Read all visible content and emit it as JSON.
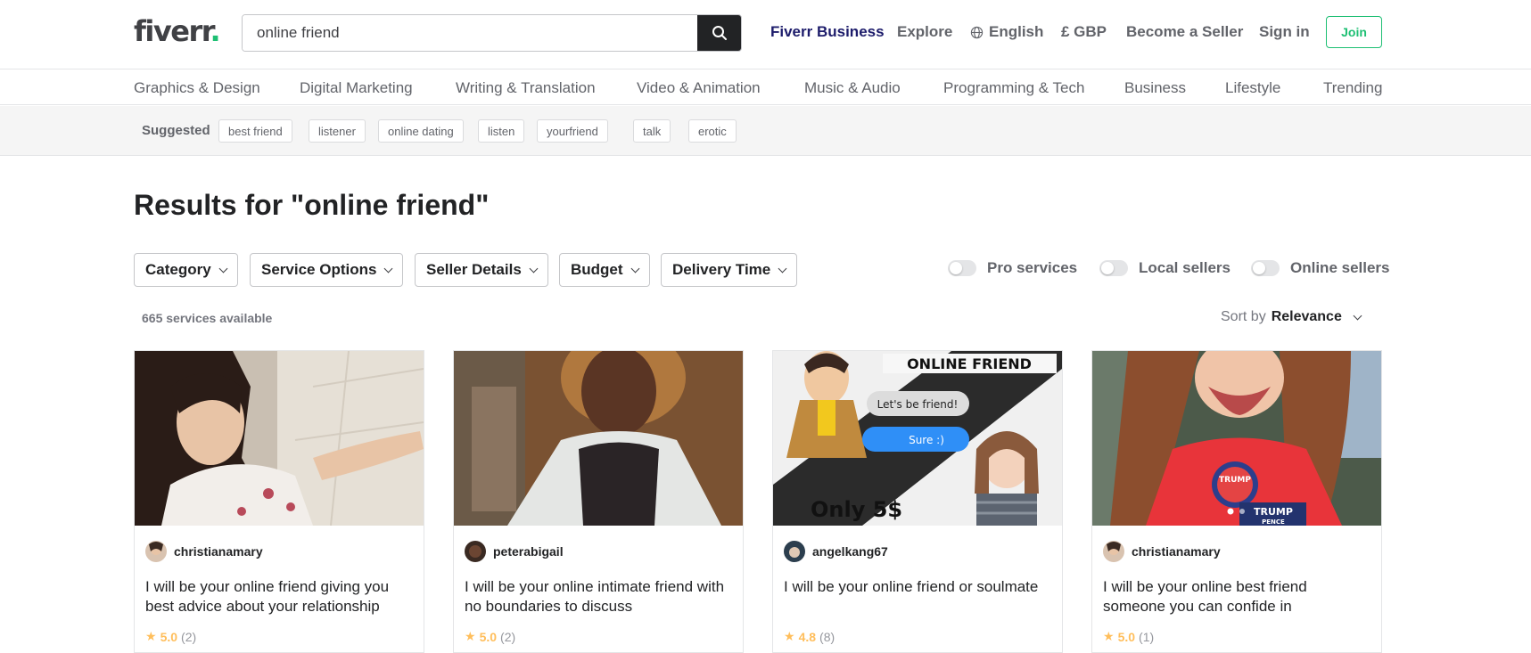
{
  "header": {
    "logo": "fiverr",
    "logo_dot": ".",
    "search_value": "online friend",
    "nav": {
      "business": "Fiverr Business",
      "explore": "Explore",
      "language": "English",
      "currency": "£ GBP",
      "become_seller": "Become a Seller",
      "sign_in": "Sign in",
      "join": "Join"
    }
  },
  "categories": [
    "Graphics & Design",
    "Digital Marketing",
    "Writing & Translation",
    "Video & Animation",
    "Music & Audio",
    "Programming & Tech",
    "Business",
    "Lifestyle",
    "Trending"
  ],
  "suggested": {
    "label": "Suggested",
    "tags": [
      "best friend",
      "listener",
      "online dating",
      "listen",
      "yourfriend",
      "talk",
      "erotic"
    ]
  },
  "results": {
    "title": "Results for \"online friend\"",
    "count": "665 services available",
    "sort_label": "Sort by",
    "sort_value": "Relevance"
  },
  "filters": [
    "Category",
    "Service Options",
    "Seller Details",
    "Budget",
    "Delivery Time"
  ],
  "toggles": [
    "Pro services",
    "Local sellers",
    "Online sellers"
  ],
  "gigs": [
    {
      "seller": "christianamary",
      "title": "I will be your online friend giving you best advice about your relationship",
      "rating": "5.0",
      "reviews": "(2)"
    },
    {
      "seller": "peterabigail",
      "title": "I will be your online intimate friend with no boundaries to discuss",
      "rating": "5.0",
      "reviews": "(2)"
    },
    {
      "seller": "angelkang67",
      "title": "I will be your online friend or soulmate",
      "rating": "4.8",
      "reviews": "(8)",
      "image_text": {
        "banner": "ONLINE FRIEND",
        "bubble1": "Let's be friend!",
        "bubble2": "Sure :)",
        "price": "Only 5$"
      }
    },
    {
      "seller": "christianamary",
      "title": "I will be your online best friend someone you can confide in",
      "rating": "5.0",
      "reviews": "(1)",
      "image_text": {
        "badge": "TRUMP",
        "badge_sub": "PENCE"
      }
    }
  ],
  "colors": {
    "brand_green": "#1dbf73",
    "business_blue": "#1d1c6b",
    "star": "#ffbe5b",
    "search_button": "#222325"
  }
}
